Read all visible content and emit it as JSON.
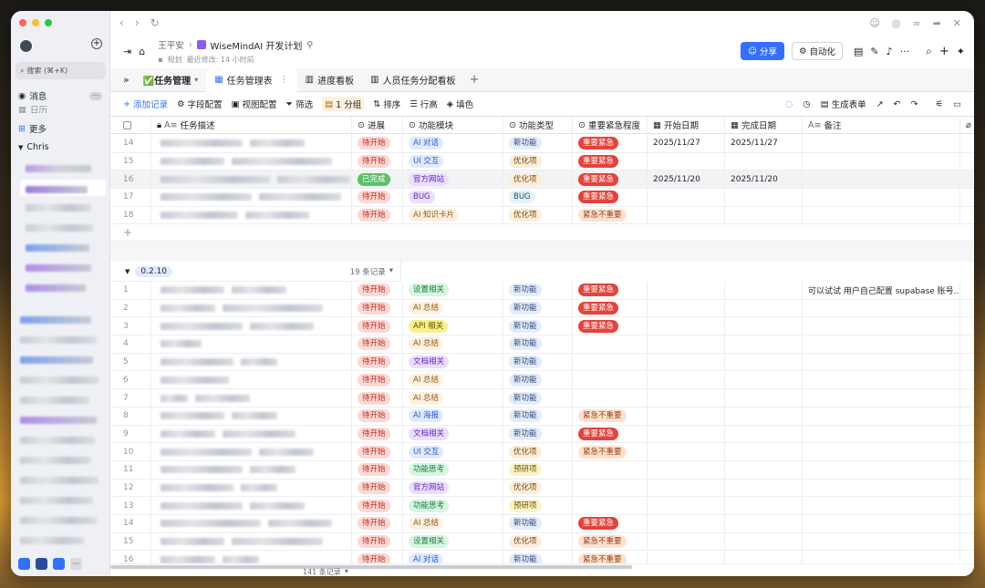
{
  "window": {
    "title": "WiseMindAI 开发计划",
    "breadcrumb_user": "王平安",
    "sub_label": "规划",
    "last_modified": "最近修改: 14 小时前"
  },
  "sidebar": {
    "search_placeholder": "搜索 (⌘+K)",
    "messages": "消息",
    "calendar": "日历",
    "more": "更多",
    "group": "Chris"
  },
  "header": {
    "share": "分享",
    "automation": "自动化"
  },
  "tabs": [
    {
      "label": "✅任务管理"
    },
    {
      "label": "任务管理表"
    },
    {
      "label": "进度看板"
    },
    {
      "label": "人员任务分配看板"
    }
  ],
  "toolbar": {
    "add": "添加记录",
    "fields": "字段配置",
    "view": "视图配置",
    "filter": "筛选",
    "group": "1 分组",
    "sort": "排序",
    "row_height": "行高",
    "fill": "填色",
    "form": "生成表单"
  },
  "columns": [
    "任务描述",
    "进展",
    "功能模块",
    "功能类型",
    "重要紧急程度",
    "开始日期",
    "完成日期",
    "备注"
  ],
  "group_top": {
    "rows": [
      {
        "n": "14",
        "status": "待开始",
        "module": "AI 对话",
        "mtag": "blue",
        "type": "新功能",
        "prio": "重要紧急",
        "start": "2025/11/27",
        "end": "2025/11/27",
        "note": ""
      },
      {
        "n": "15",
        "status": "待开始",
        "module": "UI 交互",
        "mtag": "blue",
        "type": "优化项",
        "prio": "重要紧急",
        "start": "",
        "end": "",
        "note": ""
      },
      {
        "n": "16",
        "status": "已完成",
        "module": "官方网站",
        "mtag": "purple",
        "type": "优化项",
        "prio": "重要紧急",
        "start": "2025/11/20",
        "end": "2025/11/20",
        "note": ""
      },
      {
        "n": "17",
        "status": "待开始",
        "module": "BUG",
        "mtag": "purple",
        "type": "BUG",
        "prio": "重要紧急",
        "start": "",
        "end": "",
        "note": ""
      },
      {
        "n": "18",
        "status": "待开始",
        "module": "AI 知识卡片",
        "mtag": "orange",
        "type": "优化项",
        "prio": "紧急不重要",
        "start": "",
        "end": "",
        "note": ""
      }
    ]
  },
  "group2": {
    "name": "0.2.10",
    "count": "19 条记录",
    "rows": [
      {
        "n": "1",
        "status": "待开始",
        "module": "设置相关",
        "mtag": "mint",
        "type": "新功能",
        "prio": "重要紧急",
        "note": "可以试试 用户自己配置 supabase 账号..."
      },
      {
        "n": "2",
        "status": "待开始",
        "module": "AI 总结",
        "mtag": "orange",
        "type": "新功能",
        "prio": "重要紧急",
        "note": ""
      },
      {
        "n": "3",
        "status": "待开始",
        "module": "API 相关",
        "mtag": "yellow",
        "type": "新功能",
        "prio": "重要紧急",
        "note": ""
      },
      {
        "n": "4",
        "status": "待开始",
        "module": "AI 总结",
        "mtag": "orange",
        "type": "新功能",
        "prio": "",
        "note": ""
      },
      {
        "n": "5",
        "status": "待开始",
        "module": "文档相关",
        "mtag": "purple",
        "type": "新功能",
        "prio": "",
        "note": ""
      },
      {
        "n": "6",
        "status": "待开始",
        "module": "AI 总结",
        "mtag": "orange",
        "type": "新功能",
        "prio": "",
        "note": ""
      },
      {
        "n": "7",
        "status": "待开始",
        "module": "AI 总结",
        "mtag": "orange",
        "type": "新功能",
        "prio": "",
        "note": ""
      },
      {
        "n": "8",
        "status": "待开始",
        "module": "AI 海报",
        "mtag": "blue",
        "type": "新功能",
        "prio": "紧急不重要",
        "note": ""
      },
      {
        "n": "9",
        "status": "待开始",
        "module": "文档相关",
        "mtag": "purple",
        "type": "新功能",
        "prio": "重要紧急",
        "note": ""
      },
      {
        "n": "10",
        "status": "待开始",
        "module": "UI 交互",
        "mtag": "blue",
        "type": "优化项",
        "prio": "紧急不重要",
        "note": ""
      },
      {
        "n": "11",
        "status": "待开始",
        "module": "功能思考",
        "mtag": "mint",
        "type": "预研项",
        "prio": "",
        "note": ""
      },
      {
        "n": "12",
        "status": "待开始",
        "module": "官方网站",
        "mtag": "purple",
        "type": "优化项",
        "prio": "",
        "note": ""
      },
      {
        "n": "13",
        "status": "待开始",
        "module": "功能思考",
        "mtag": "mint",
        "type": "预研项",
        "prio": "",
        "note": ""
      },
      {
        "n": "14",
        "status": "待开始",
        "module": "AI 总结",
        "mtag": "orange",
        "type": "新功能",
        "prio": "重要紧急",
        "note": ""
      },
      {
        "n": "15",
        "status": "待开始",
        "module": "设置相关",
        "mtag": "mint",
        "type": "优化项",
        "prio": "紧急不重要",
        "note": ""
      },
      {
        "n": "16",
        "status": "待开始",
        "module": "AI 对话",
        "mtag": "blue",
        "type": "新功能",
        "prio": "紧急不重要",
        "note": ""
      }
    ]
  },
  "footer": {
    "total": "141 条记录"
  }
}
